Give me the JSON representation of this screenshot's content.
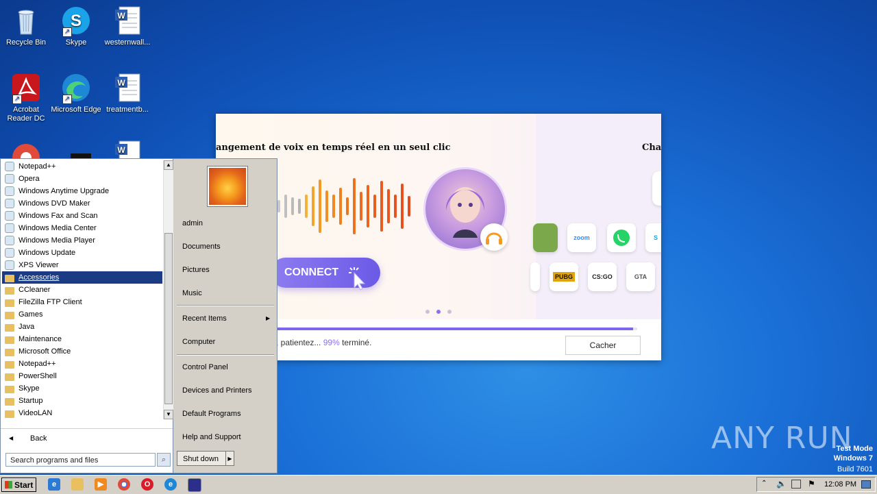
{
  "desktop_icons": [
    {
      "label": "Recycle Bin",
      "icon": "recycle-bin-icon"
    },
    {
      "label": "Skype",
      "icon": "skype-icon"
    },
    {
      "label": "westernwall...",
      "icon": "word-doc-icon"
    },
    {
      "label": "Acrobat Reader DC",
      "icon": "acrobat-icon"
    },
    {
      "label": "Microsoft Edge",
      "icon": "edge-icon"
    },
    {
      "label": "treatmentb...",
      "icon": "word-doc-icon"
    }
  ],
  "installer": {
    "banner_title_left": "angement de voix en temps réel en un seul clic",
    "banner_title_right": "Chan",
    "connect_label": "CONNECT",
    "app_tiles": [
      "zoom",
      "PUBG",
      "CS:GO",
      "GTA"
    ],
    "status_prefix": ", patientez... ",
    "status_percent": "99%",
    "status_suffix": " terminé.",
    "progress": 0.99,
    "hide_label": "Cacher",
    "accent": "#7f66ee"
  },
  "start_menu": {
    "programs": [
      {
        "label": "Notepad++",
        "icon": "notepadpp-icon",
        "folder": false
      },
      {
        "label": "Opera",
        "icon": "opera-icon",
        "folder": false
      },
      {
        "label": "Windows Anytime Upgrade",
        "icon": "windows-upgrade-icon",
        "folder": false
      },
      {
        "label": "Windows DVD Maker",
        "icon": "dvd-maker-icon",
        "folder": false
      },
      {
        "label": "Windows Fax and Scan",
        "icon": "fax-scan-icon",
        "folder": false
      },
      {
        "label": "Windows Media Center",
        "icon": "media-center-icon",
        "folder": false
      },
      {
        "label": "Windows Media Player",
        "icon": "media-player-icon",
        "folder": false
      },
      {
        "label": "Windows Update",
        "icon": "windows-update-icon",
        "folder": false
      },
      {
        "label": "XPS Viewer",
        "icon": "xps-viewer-icon",
        "folder": false
      },
      {
        "label": "Accessories",
        "icon": "folder-icon",
        "folder": true,
        "selected": true
      },
      {
        "label": "CCleaner",
        "icon": "folder-icon",
        "folder": true
      },
      {
        "label": "FileZilla FTP Client",
        "icon": "folder-icon",
        "folder": true
      },
      {
        "label": "Games",
        "icon": "folder-icon",
        "folder": true
      },
      {
        "label": "Java",
        "icon": "folder-icon",
        "folder": true
      },
      {
        "label": "Maintenance",
        "icon": "folder-icon",
        "folder": true
      },
      {
        "label": "Microsoft Office",
        "icon": "folder-icon",
        "folder": true
      },
      {
        "label": "Notepad++",
        "icon": "folder-icon",
        "folder": true
      },
      {
        "label": "PowerShell",
        "icon": "folder-icon",
        "folder": true
      },
      {
        "label": "Skype",
        "icon": "folder-icon",
        "folder": true
      },
      {
        "label": "Startup",
        "icon": "folder-icon",
        "folder": true
      },
      {
        "label": "VideoLAN",
        "icon": "folder-icon",
        "folder": true
      }
    ],
    "back_label": "Back",
    "search_placeholder": "Search programs and files",
    "right_items": {
      "user": "admin",
      "documents": "Documents",
      "pictures": "Pictures",
      "music": "Music",
      "recent": "Recent Items",
      "computer": "Computer",
      "control_panel": "Control Panel",
      "devices": "Devices and Printers",
      "defaults": "Default Programs",
      "help": "Help and Support"
    },
    "shutdown_label": "Shut down"
  },
  "taskbar": {
    "start_label": "Start",
    "pinned": [
      "ie-icon",
      "explorer-icon",
      "media-player-icon",
      "chrome-icon",
      "opera-icon",
      "edge-icon",
      "installer-app-icon"
    ],
    "clock": "12:08 PM"
  },
  "watermark": {
    "line1": "Test Mode",
    "line2": "Windows 7",
    "line3": "Build 7601",
    "brand": "ANY RUN"
  }
}
